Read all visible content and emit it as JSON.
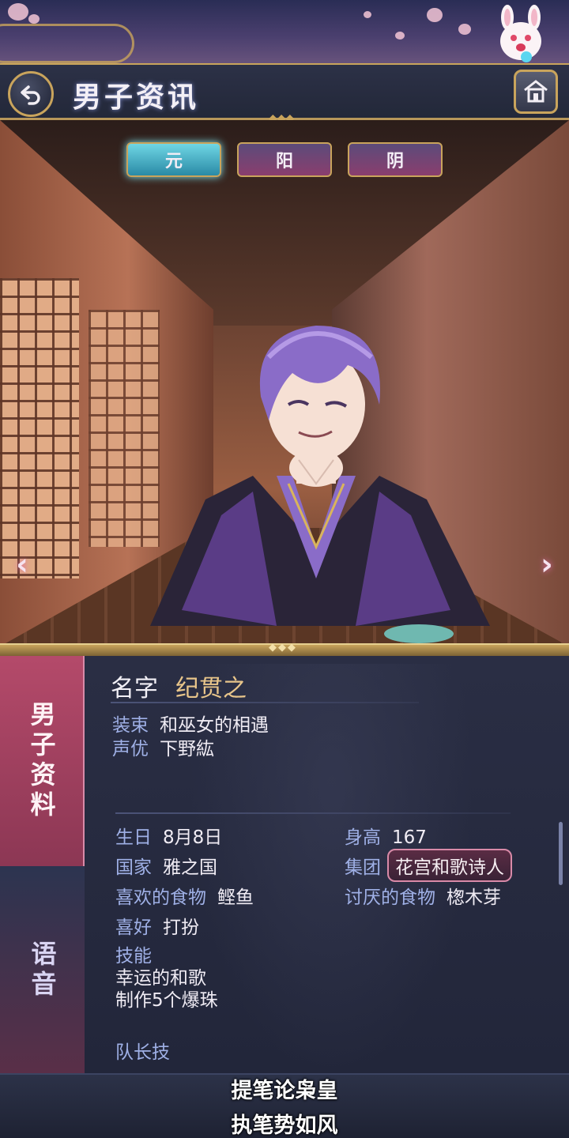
{
  "header": {
    "title": "男子资讯"
  },
  "form_tabs": [
    {
      "label": "元",
      "active": true
    },
    {
      "label": "阳",
      "active": false
    },
    {
      "label": "阴",
      "active": false
    }
  ],
  "side_tabs": {
    "profile": "男子资料",
    "voice": "语音"
  },
  "profile": {
    "name_label": "名字",
    "name": "纪贯之",
    "outfit_label": "装束",
    "outfit": "和巫女的相遇",
    "cv_label": "声优",
    "cv": "下野紘",
    "birthday_label": "生日",
    "birthday": "8月8日",
    "height_label": "身高",
    "height": "167",
    "country_label": "国家",
    "country": "雅之国",
    "group_label": "集团",
    "group": "花宫和歌诗人",
    "liked_food_label": "喜欢的食物",
    "liked_food": "鲣鱼",
    "disliked_food_label": "讨厌的食物",
    "disliked_food": "楤木芽",
    "hobby_label": "喜好",
    "hobby": "打扮",
    "skills_label": "技能",
    "skills": [
      "幸运的和歌",
      "制作5个爆珠"
    ],
    "leader_skill_label": "队长技"
  },
  "subtitles": [
    "提笔论枭皇",
    "执笔势如风"
  ],
  "colors": {
    "accent_gold": "#c9a45c",
    "active_tab": "#2a8aa6",
    "profile_tab": "#b44a6a",
    "name_value": "#e8c58a",
    "label": "#9fb0e6"
  }
}
